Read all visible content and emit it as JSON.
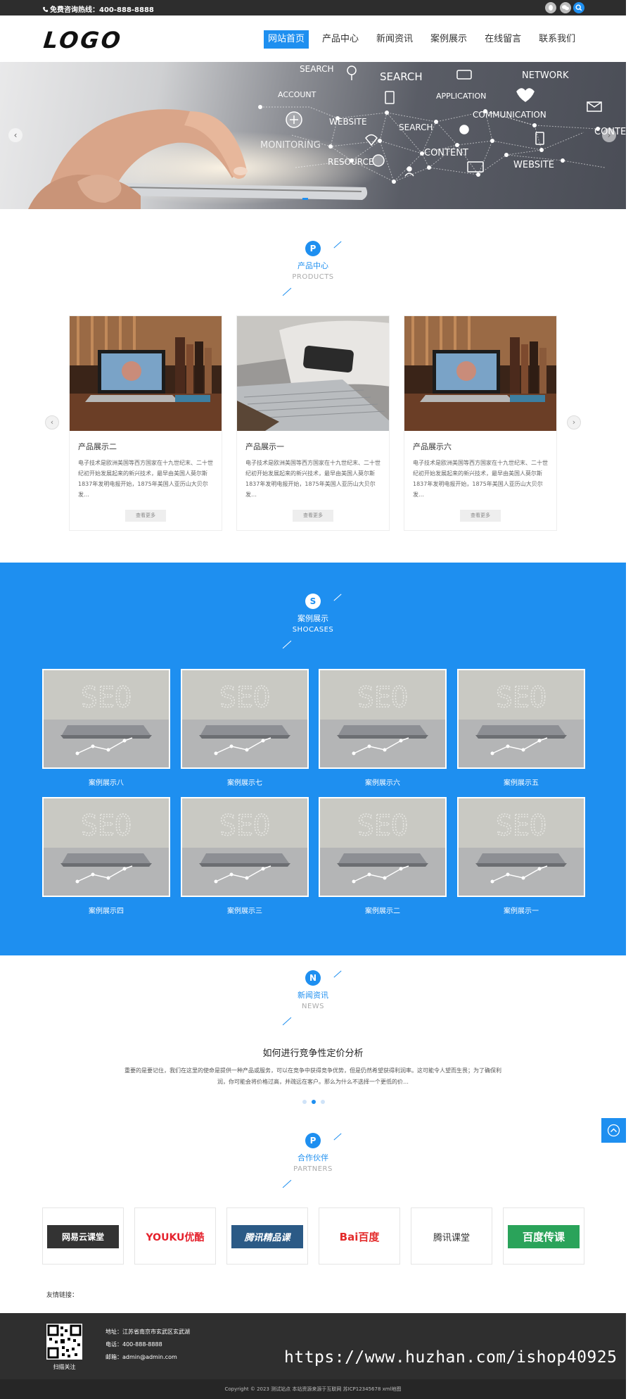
{
  "topbar": {
    "hotline": "免费咨询热线：400-888-8888"
  },
  "header": {
    "logo": "LOGO",
    "nav": [
      "网站首页",
      "产品中心",
      "新闻资讯",
      "案例展示",
      "在线留言",
      "联系我们"
    ]
  },
  "banner": {
    "words": [
      "SEARCH",
      "ACCOUNT",
      "SEARCH",
      "APPLICATION",
      "NETWORK",
      "WEBSITE",
      "COMMUNICATION",
      "SEARCH",
      "MONITORING",
      "RESOURCE",
      "CONTENT",
      "WEBSITE",
      "CONTE"
    ]
  },
  "products": {
    "letter": "P",
    "title": "产品中心",
    "subtitle": "PRODUCTS",
    "items": [
      {
        "name": "产品展示二",
        "desc": "电子技术是欧洲美国等西方国家在十九世纪末、二十世纪初开始发展起来的新兴技术，最早由美国人莫尔斯1837年发明电报开始，1875年美国人亚历山大贝尔发…",
        "more": "查看更多"
      },
      {
        "name": "产品展示一",
        "desc": "电子技术是欧洲美国等西方国家在十九世纪末、二十世纪初开始发展起来的新兴技术，最早由美国人莫尔斯1837年发明电报开始，1875年美国人亚历山大贝尔发…",
        "more": "查看更多"
      },
      {
        "name": "产品展示六",
        "desc": "电子技术是欧洲美国等西方国家在十九世纪末、二十世纪初开始发展起来的新兴技术，最早由美国人莫尔斯1837年发明电报开始，1875年美国人亚历山大贝尔发…",
        "more": "查看更多"
      }
    ]
  },
  "cases": {
    "letter": "S",
    "title": "案例展示",
    "subtitle": "SHOCASES",
    "image_text": "SEO",
    "items": [
      "案例展示八",
      "案例展示七",
      "案例展示六",
      "案例展示五",
      "案例展示四",
      "案例展示三",
      "案例展示二",
      "案例展示一"
    ]
  },
  "news": {
    "letter": "N",
    "title": "新闻资讯",
    "subtitle": "NEWS",
    "headline": "如何进行竞争性定价分析",
    "summary": "重要的是要记住，我们在这里的使命是提供一种产品或服务，可以在竞争中获得竞争优势，但是仍然希望获得利润率。这可能令人望而生畏；为了确保利润，你可能会将价格过高，并疏远在客户。那么为什么不选择一个更低的价…"
  },
  "partners": {
    "letter": "P",
    "title": "合作伙伴",
    "subtitle": "PARTNERS",
    "items": [
      {
        "label": "网易云课堂"
      },
      {
        "label": "YOUKU优酷"
      },
      {
        "label": "腾讯精品课"
      },
      {
        "label": "Bai百度"
      },
      {
        "label": "腾讯课堂"
      },
      {
        "label": "百度传课"
      }
    ]
  },
  "links": {
    "label": "友情链接："
  },
  "footer": {
    "qr_caption": "扫描关注",
    "address": "地址：江苏省南京市玄武区玄武湖",
    "phone": "电话：400-888-8888",
    "email": "邮箱：admin@admin.com",
    "watermark": "https://www.huzhan.com/ishop40925",
    "copyright": "Copyright © 2023 测试站点 本站资源来源于互联网 苏ICP12345678 xml地图"
  },
  "colors": {
    "accent": "#1e8ff0",
    "topbar": "#2d2d2d",
    "footer": "#2f2f2f"
  }
}
